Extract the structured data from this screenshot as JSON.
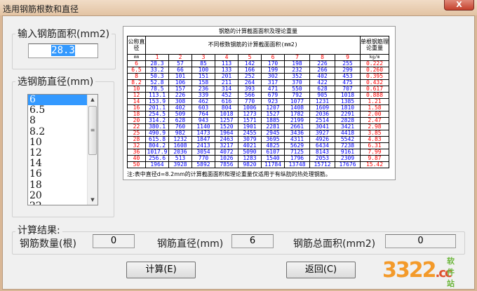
{
  "window": {
    "title": "选用钢筋根数和直径",
    "close_label": "X"
  },
  "area_group": {
    "label": "输入钢筋面积(mm2)",
    "value": "28.3"
  },
  "diameter_group": {
    "label": "选钢筋直径(mm)",
    "items": [
      "6",
      "6.5",
      "8",
      "8.2",
      "10",
      "12",
      "14",
      "16",
      "18",
      "20",
      "22"
    ],
    "selected": "6"
  },
  "table": {
    "title": "钢筋的计算截面面积及理论重量",
    "col_diameter": "公称直径",
    "unit_mm": "mm",
    "area_header": "不同根数钢筋的计算截面面积(mm2)",
    "weight_header": "单根钢筋理论重量",
    "weight_unit": "kg/m",
    "counts": [
      "1",
      "2",
      "3",
      "4",
      "5",
      "6",
      "7",
      "8",
      "9"
    ],
    "rows": [
      {
        "d": "6",
        "a": [
          "28.3",
          "57",
          "85",
          "113",
          "142",
          "170",
          "198",
          "226",
          "255"
        ],
        "w": "0.222"
      },
      {
        "d": "6.5",
        "a": [
          "33.2",
          "66",
          "100",
          "133",
          "166",
          "199",
          "232",
          "266",
          "299"
        ],
        "w": "0.260"
      },
      {
        "d": "8",
        "a": [
          "50.3",
          "101",
          "151",
          "201",
          "252",
          "302",
          "352",
          "402",
          "453"
        ],
        "w": "0.395"
      },
      {
        "d": "8.2",
        "a": [
          "52.8",
          "106",
          "158",
          "211",
          "264",
          "317",
          "370",
          "422",
          "475"
        ],
        "w": "0.432"
      },
      {
        "d": "10",
        "a": [
          "78.5",
          "157",
          "236",
          "314",
          "393",
          "471",
          "550",
          "628",
          "707"
        ],
        "w": "0.617"
      },
      {
        "d": "12",
        "a": [
          "113.1",
          "226",
          "339",
          "452",
          "566",
          "679",
          "792",
          "905",
          "1018"
        ],
        "w": "0.888"
      },
      {
        "d": "14",
        "a": [
          "153.9",
          "308",
          "462",
          "616",
          "770",
          "923",
          "1077",
          "1231",
          "1385"
        ],
        "w": "1.21"
      },
      {
        "d": "16",
        "a": [
          "201.1",
          "402",
          "603",
          "804",
          "1006",
          "1207",
          "1408",
          "1609",
          "1810"
        ],
        "w": "1.58"
      },
      {
        "d": "18",
        "a": [
          "254.5",
          "509",
          "764",
          "1018",
          "1273",
          "1527",
          "1782",
          "2036",
          "2291"
        ],
        "w": "2.00"
      },
      {
        "d": "20",
        "a": [
          "314.2",
          "628",
          "943",
          "1257",
          "1571",
          "1885",
          "2199",
          "2514",
          "2828"
        ],
        "w": "2.47"
      },
      {
        "d": "22",
        "a": [
          "380.1",
          "760",
          "1140",
          "1520",
          "1901",
          "2281",
          "2661",
          "3041",
          "3421"
        ],
        "w": "2.98"
      },
      {
        "d": "25",
        "a": [
          "490.9",
          "982",
          "1473",
          "1964",
          "2455",
          "2945",
          "3436",
          "3927",
          "4418"
        ],
        "w": "3.85"
      },
      {
        "d": "28",
        "a": [
          "615.8",
          "1232",
          "1847",
          "2463",
          "3079",
          "3695",
          "4311",
          "4926",
          "5542"
        ],
        "w": "4.83"
      },
      {
        "d": "32",
        "a": [
          "804.2",
          "1608",
          "2413",
          "3217",
          "4021",
          "4825",
          "5629",
          "6434",
          "7238"
        ],
        "w": "6.31"
      },
      {
        "d": "36",
        "a": [
          "1017.9",
          "2036",
          "3054",
          "4072",
          "5090",
          "6107",
          "7125",
          "8143",
          "9161"
        ],
        "w": "7.99"
      },
      {
        "d": "40",
        "a": [
          "256.6",
          "513",
          "770",
          "1026",
          "1283",
          "1540",
          "1796",
          "2053",
          "2309"
        ],
        "w": "9.87"
      },
      {
        "d": "50",
        "a": [
          "1964",
          "3928",
          "5892",
          "7856",
          "9820",
          "11784",
          "13748",
          "15712",
          "17676"
        ],
        "w": "15.42"
      }
    ],
    "note": "注:表中直径d=8.2mm的计算截面面积和理论重量仅适用于有纵肋的热处理钢筋。"
  },
  "results": {
    "label": "计算结果:",
    "count_label": "钢筋数量(根)",
    "count_value": "0",
    "diameter_label": "钢筋直径(mm)",
    "diameter_value": "6",
    "total_label": "钢筋总面积(mm2)",
    "total_value": "0"
  },
  "buttons": {
    "calc": "计算(E)",
    "back": "返回(C)"
  },
  "watermark": {
    "text": "3322",
    "suffix": ".cc",
    "tag": "软件站"
  },
  "colors": {
    "selection": "#3399ff",
    "header_red": "#ff0000",
    "area_blue": "#0000ff"
  }
}
